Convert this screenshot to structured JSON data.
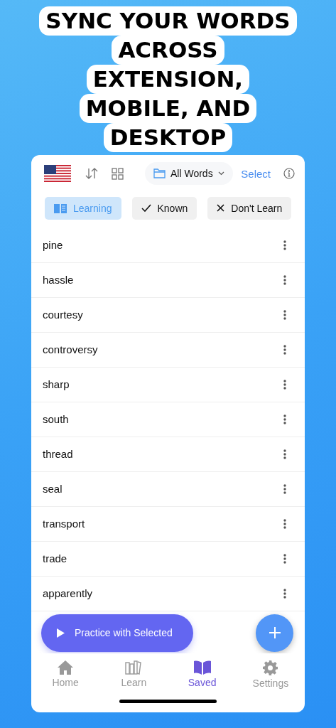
{
  "headline": [
    "SYNC YOUR WORDS",
    "ACROSS",
    "EXTENSION,",
    "MOBILE, AND",
    "DESKTOP"
  ],
  "toolbar": {
    "folder": "All Words",
    "select": "Select"
  },
  "filters": [
    {
      "label": "Learning",
      "kind": "book",
      "selected": true
    },
    {
      "label": "Known",
      "kind": "check",
      "selected": false
    },
    {
      "label": "Don't Learn",
      "kind": "cross",
      "selected": false
    }
  ],
  "words": [
    "pine",
    "hassle",
    "courtesy",
    "controversy",
    "sharp",
    "south",
    "thread",
    "seal",
    "transport",
    "trade",
    "apparently"
  ],
  "practice_button": "Practice with Selected",
  "tabs": [
    {
      "label": "Home",
      "kind": "home",
      "selected": false
    },
    {
      "label": "Learn",
      "kind": "learn",
      "selected": false
    },
    {
      "label": "Saved",
      "kind": "saved",
      "selected": true
    },
    {
      "label": "Settings",
      "kind": "settings",
      "selected": false
    }
  ]
}
